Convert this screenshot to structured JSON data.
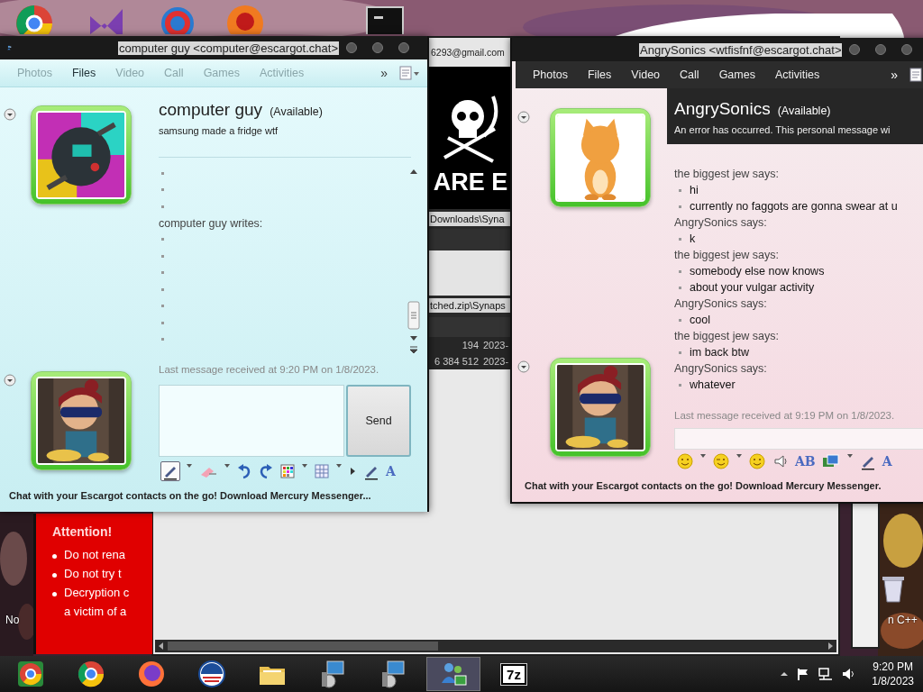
{
  "desktop": {
    "icon_labels": [
      {
        "text": "No"
      },
      {
        "text": "n C++"
      }
    ]
  },
  "archive_window": {
    "account": "6293@gmail.com",
    "banner": "ARE E",
    "path": "Downloads\\Syna",
    "archive_path": "tched.zip\\Synaps",
    "rows": [
      {
        "size": "194",
        "date": "2023-"
      },
      {
        "size": "6 384 512",
        "date": "2023-"
      }
    ]
  },
  "ransom_note": {
    "heading": "Attention!",
    "items": [
      {
        "lines": [
          "Do not rena"
        ]
      },
      {
        "lines": [
          "Do not try t"
        ]
      },
      {
        "lines": [
          "Decryption c",
          "a victim of a"
        ]
      }
    ]
  },
  "chat_windows": [
    {
      "kind": "light",
      "title": "computer guy <computer@escargot.chat>",
      "tabs": [
        {
          "label": "Photos",
          "selected": false
        },
        {
          "label": "Files",
          "selected": true
        },
        {
          "label": "Video",
          "selected": false
        },
        {
          "label": "Call",
          "selected": false
        },
        {
          "label": "Games",
          "selected": false
        },
        {
          "label": "Activities",
          "selected": false
        }
      ],
      "overflow": "»",
      "contact": {
        "name": "computer guy",
        "status": "(Available)",
        "message": "samsung made a fridge wtf"
      },
      "conversation": [
        {
          "kind": "bullet"
        },
        {
          "kind": "bullet"
        },
        {
          "kind": "bullet"
        },
        {
          "kind": "sender",
          "text": "computer guy writes:"
        },
        {
          "kind": "bullet"
        },
        {
          "kind": "bullet"
        },
        {
          "kind": "bullet"
        },
        {
          "kind": "bullet"
        },
        {
          "kind": "bullet"
        },
        {
          "kind": "bullet"
        },
        {
          "kind": "bullet"
        }
      ],
      "last_message": "Last message received at 9:20 PM on 1/8/2023.",
      "send_button": "Send",
      "toolbar": [
        {
          "kind": "pen",
          "selected": true
        },
        {
          "kind": "caret"
        },
        {
          "kind": "eraser"
        },
        {
          "kind": "caret"
        },
        {
          "kind": "undo"
        },
        {
          "kind": "redo"
        },
        {
          "kind": "palette"
        },
        {
          "kind": "caret"
        },
        {
          "kind": "grid"
        },
        {
          "kind": "caret"
        },
        {
          "kind": "arrow"
        },
        {
          "kind": "pen",
          "selected": false
        },
        {
          "kind": "label",
          "text": "A"
        }
      ],
      "footer": "Chat with your Escargot contacts on the go! Download Mercury Messenger..."
    },
    {
      "kind": "dark",
      "title": "AngrySonics <wtfisfnf@escargot.chat>",
      "tabs": [
        {
          "label": "Photos",
          "selected": false
        },
        {
          "label": "Files",
          "selected": false
        },
        {
          "label": "Video",
          "selected": false
        },
        {
          "label": "Call",
          "selected": false
        },
        {
          "label": "Games",
          "selected": false
        },
        {
          "label": "Activities",
          "selected": false
        }
      ],
      "overflow": "»",
      "contact": {
        "name": "AngrySonics",
        "status": "(Available)",
        "message": "An error has occurred. This personal message wi"
      },
      "conversation": [
        {
          "kind": "sender",
          "text": "the biggest jew says:"
        },
        {
          "kind": "message",
          "text": "hi"
        },
        {
          "kind": "message",
          "text": "currently no faggots are gonna swear at u"
        },
        {
          "kind": "sender",
          "text": "AngrySonics says:"
        },
        {
          "kind": "message",
          "text": "k"
        },
        {
          "kind": "sender",
          "text": "the biggest jew says:"
        },
        {
          "kind": "message",
          "text": "somebody else now knows"
        },
        {
          "kind": "message",
          "text": "about your vulgar activity"
        },
        {
          "kind": "sender",
          "text": "AngrySonics says:"
        },
        {
          "kind": "message",
          "text": "cool"
        },
        {
          "kind": "sender",
          "text": "the biggest jew says:"
        },
        {
          "kind": "message",
          "text": "im back btw"
        },
        {
          "kind": "sender",
          "text": "AngrySonics says:"
        },
        {
          "kind": "message",
          "text": "whatever"
        }
      ],
      "last_message": "Last message received at 9:19 PM on 1/8/2023.",
      "toolbar": [
        {
          "kind": "smiley"
        },
        {
          "kind": "caret"
        },
        {
          "kind": "wink"
        },
        {
          "kind": "caret"
        },
        {
          "kind": "smiley"
        },
        {
          "kind": "nudge"
        },
        {
          "kind": "label",
          "text": "AB"
        },
        {
          "kind": "images"
        },
        {
          "kind": "caret"
        },
        {
          "kind": "pen",
          "selected": false
        },
        {
          "kind": "label",
          "text": "A"
        }
      ],
      "footer": "Chat with your Escargot contacts on the go! Download Mercury Messenger."
    }
  ],
  "taskbar": {
    "apps": [
      {
        "kind": "colorbrowser",
        "selected": false
      },
      {
        "kind": "browser",
        "selected": false
      },
      {
        "kind": "fox",
        "selected": false
      },
      {
        "kind": "globe",
        "selected": false
      },
      {
        "kind": "folder",
        "selected": false
      },
      {
        "kind": "installer",
        "selected": false
      },
      {
        "kind": "installer",
        "selected": false
      },
      {
        "kind": "people",
        "selected": true
      },
      {
        "kind": "archive",
        "text": "7z",
        "selected": false
      }
    ],
    "time": "9:20 PM",
    "date": "1/8/2023"
  }
}
